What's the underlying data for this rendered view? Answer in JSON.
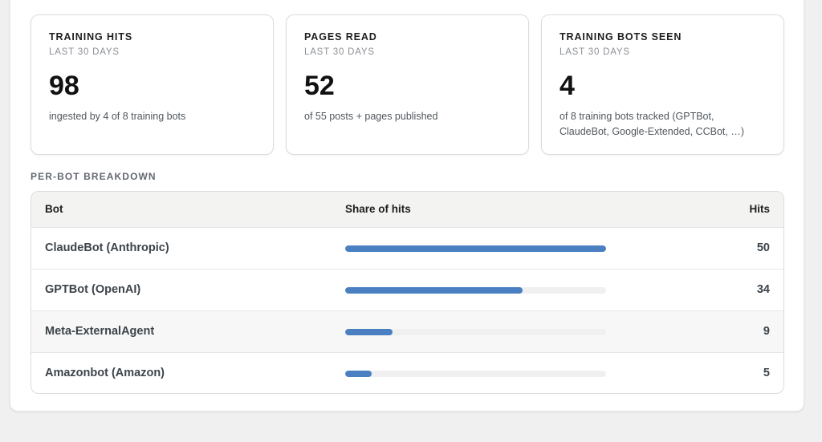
{
  "stats": [
    {
      "title": "TRAINING HITS",
      "period": "LAST 30 DAYS",
      "value": "98",
      "description": "ingested by 4 of 8 training bots"
    },
    {
      "title": "PAGES READ",
      "period": "LAST 30 DAYS",
      "value": "52",
      "description": "of 55 posts + pages published"
    },
    {
      "title": "TRAINING BOTS SEEN",
      "period": "LAST 30 DAYS",
      "value": "4",
      "description": "of 8 training bots tracked (GPTBot, ClaudeBot, Google-Extended, CCBot, …)"
    }
  ],
  "breakdown": {
    "heading": "PER-BOT BREAKDOWN",
    "columns": {
      "bot": "Bot",
      "share": "Share of hits",
      "hits": "Hits"
    },
    "rows": [
      {
        "bot": "ClaudeBot (Anthropic)",
        "hits": "50",
        "share": 1.0
      },
      {
        "bot": "GPTBot (OpenAI)",
        "hits": "34",
        "share": 0.68
      },
      {
        "bot": "Meta-ExternalAgent",
        "hits": "9",
        "share": 0.18
      },
      {
        "bot": "Amazonbot (Amazon)",
        "hits": "5",
        "share": 0.1
      }
    ]
  },
  "colors": {
    "bar_fill": "#4a80c2",
    "bar_track": "#f0f0f1"
  }
}
